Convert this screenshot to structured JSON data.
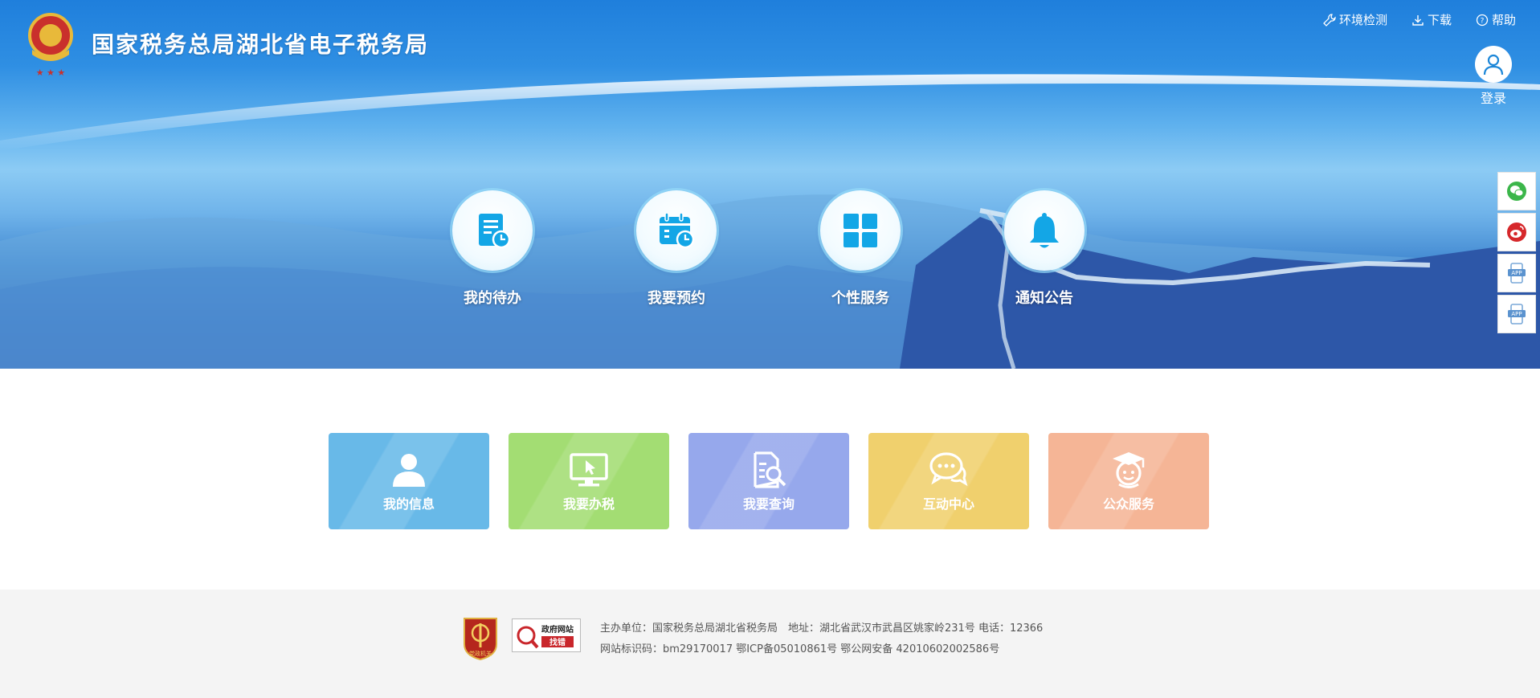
{
  "header": {
    "site_title": "国家税务总局湖北省电子税务局",
    "logo_icon": "tax-emblem-icon",
    "links": [
      {
        "label": "环境检测",
        "icon": "wrench-icon"
      },
      {
        "label": "下载",
        "icon": "download-icon"
      },
      {
        "label": "帮助",
        "icon": "help-circle-icon"
      }
    ],
    "login_label": "登录"
  },
  "quick_actions": [
    {
      "label": "我的待办",
      "icon": "todo-list-icon"
    },
    {
      "label": "我要预约",
      "icon": "calendar-clock-icon"
    },
    {
      "label": "个性服务",
      "icon": "grid-icon"
    },
    {
      "label": "通知公告",
      "icon": "bell-icon"
    }
  ],
  "social": [
    {
      "icon": "wechat-icon"
    },
    {
      "icon": "weibo-icon"
    },
    {
      "icon": "app-icon",
      "label": "APP"
    },
    {
      "icon": "app-icon",
      "label": "APP"
    }
  ],
  "cards": [
    {
      "label": "我的信息",
      "icon": "user-icon",
      "color": "#68b9e8"
    },
    {
      "label": "我要办税",
      "icon": "monitor-icon",
      "color": "#a3dd73"
    },
    {
      "label": "我要查询",
      "icon": "search-document-icon",
      "color": "#96a8ec"
    },
    {
      "label": "互动中心",
      "icon": "chat-bubble-icon",
      "color": "#f0d06d"
    },
    {
      "label": "公众服务",
      "icon": "graduate-icon",
      "color": "#f5b596"
    }
  ],
  "footer": {
    "line1": "主办单位：国家税务总局湖北省税务局　地址：湖北省武汉市武昌区姚家岭231号  电话：12366",
    "line2": "网站标识码：bm29170017   鄂ICP备05010861号  鄂公网安备 42010602002586号",
    "badge_party": "党政机关",
    "badge_gov_line1": "政府网站",
    "badge_gov_line2": "找错"
  },
  "colors": {
    "sky_top": "#1f7fdc",
    "icon_blue": "#13a6e6"
  }
}
